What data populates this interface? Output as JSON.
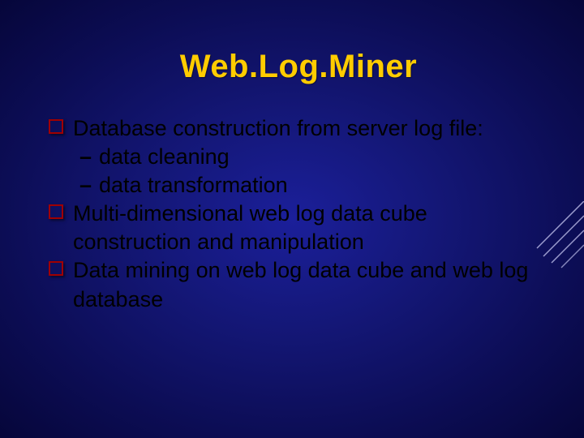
{
  "title": "Web.Log.Miner",
  "bullets": [
    {
      "text": "Database construction from server log file:"
    },
    {
      "subtext": "data cleaning"
    },
    {
      "subtext": "data transformation"
    },
    {
      "text": "Multi-dimensional web log data cube construction and manipulation"
    },
    {
      "text": "Data mining on web log data cube and web log database"
    }
  ]
}
